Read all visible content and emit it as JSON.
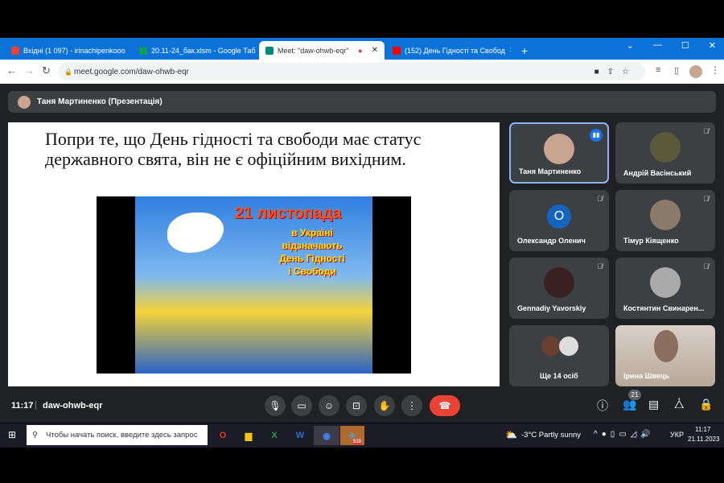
{
  "browser": {
    "tabs": [
      {
        "title": "Вхідні (1 097) - irinachipenkooo",
        "color": "#ea4335"
      },
      {
        "title": "20.11-24_бак.xlsm - Google Таб",
        "color": "#0f9d58"
      },
      {
        "title": "Meet: \"daw-ohwb-eqr\"",
        "color": "#00897b"
      },
      {
        "title": "(152) День Гідності та Свобод",
        "color": "#ff0000"
      }
    ],
    "new_tab": "+",
    "url": "meet.google.com/daw-ohwb-eqr"
  },
  "meet": {
    "presenter": "Таня Мартиненко (Презентація)",
    "slide_text": "Попри те, що День гідності та свободи має статус державного свята, він не є офіційним вихідним.",
    "poster_lines": [
      "21 листопада",
      "в Україні",
      "відзначають",
      "День Гідності",
      "і Свободи"
    ],
    "participants": [
      {
        "name": "Таня Мартиненко",
        "speaking": true
      },
      {
        "name": "Андрій Васінський"
      },
      {
        "name": "Олександр Оленич",
        "initial": "О"
      },
      {
        "name": "Тімур Кіященко"
      },
      {
        "name": "Gennadiy Yavorskiy"
      },
      {
        "name": "Костянтин Свинарен..."
      },
      {
        "name": "Ще 14 осіб"
      },
      {
        "name": "Ірина Швець"
      }
    ],
    "time": "11:17",
    "meeting_code": "daw-ohwb-eqr",
    "participant_count": "21",
    "end_call_color": "#ea4335"
  },
  "taskbar": {
    "search_placeholder": "Чтобы начать поиск, введите здесь запрос",
    "weather": "-3°C  Partly sunny",
    "lang": "УКР",
    "time": "11:17",
    "date": "21.11.2023",
    "telegram_badge": "510"
  }
}
